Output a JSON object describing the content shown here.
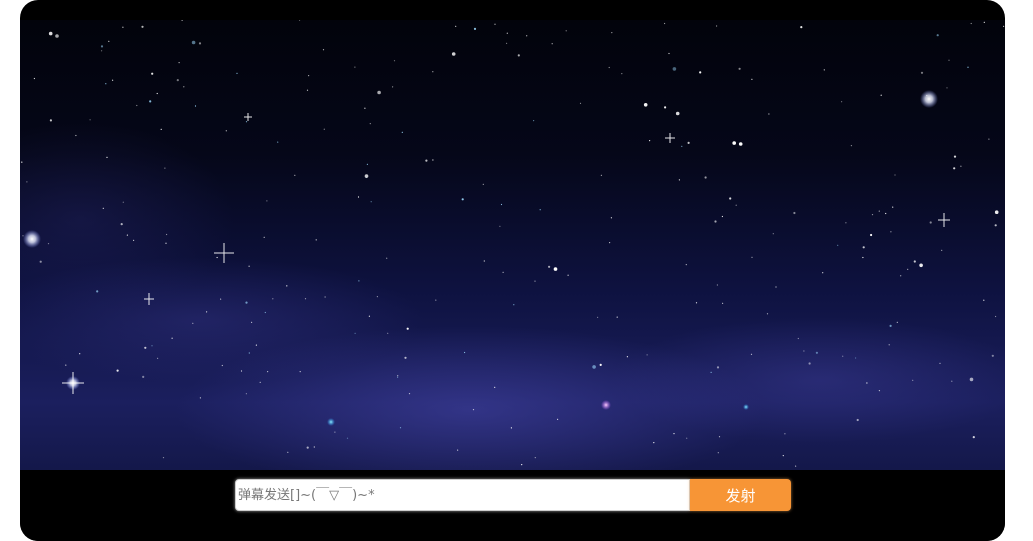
{
  "danmu_bar": {
    "input_value": "",
    "input_placeholder": "弹幕发送[]~(￣▽￣)~*",
    "fire_button_label": "发射"
  },
  "colors": {
    "frame_background": "#000000",
    "fire_button_background": "#f79536",
    "fire_button_text": "#ffffff",
    "input_background": "#ffffff"
  },
  "background_image": "starry-night-sky"
}
